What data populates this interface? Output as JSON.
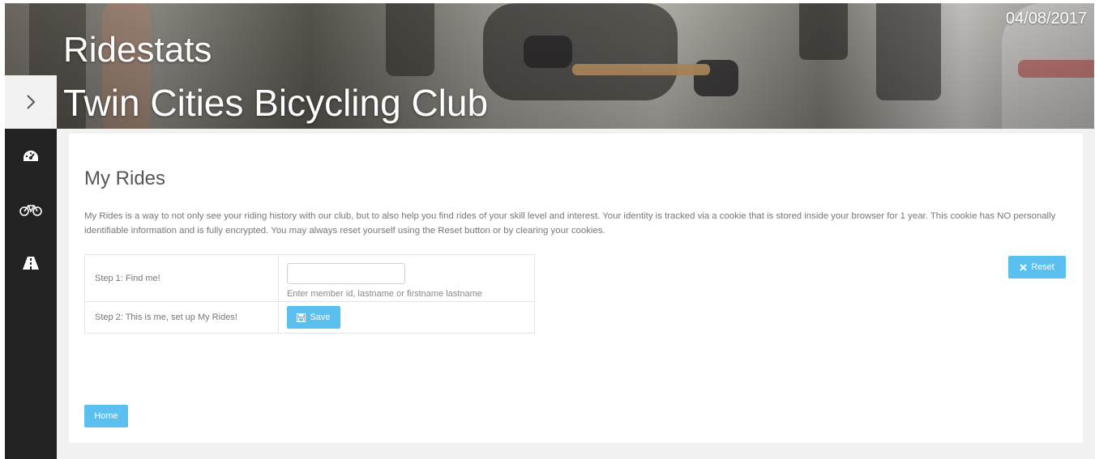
{
  "header": {
    "site_title": "Ridestats",
    "club_name": "Twin Cities Bicycling Club",
    "date": "04/08/2017"
  },
  "sidebar": {
    "toggle_icon": "chevron-right-icon",
    "items": [
      {
        "icon": "dashboard-icon"
      },
      {
        "icon": "bicycle-icon"
      },
      {
        "icon": "road-icon"
      }
    ]
  },
  "main": {
    "title": "My Rides",
    "intro": "My Rides is a way to not only see your riding history with our club, but to also help you find rides of your skill level and interest. Your identity is tracked via a cookie that is stored inside your browser for 1 year. This cookie has NO personally identifiable information and is fully encrypted. You may always reset yourself using the Reset button or by clearing your cookies.",
    "steps": [
      {
        "label": "Step 1: Find me!",
        "input_value": "",
        "help": "Enter member id, lastname or firstname lastname"
      },
      {
        "label": "Step 2: This is me, set up My Rides!",
        "button_label": "Save"
      }
    ],
    "reset_label": "Reset",
    "home_label": "Home"
  },
  "colors": {
    "accent": "#5bc0f0",
    "sidebar": "#222222"
  }
}
